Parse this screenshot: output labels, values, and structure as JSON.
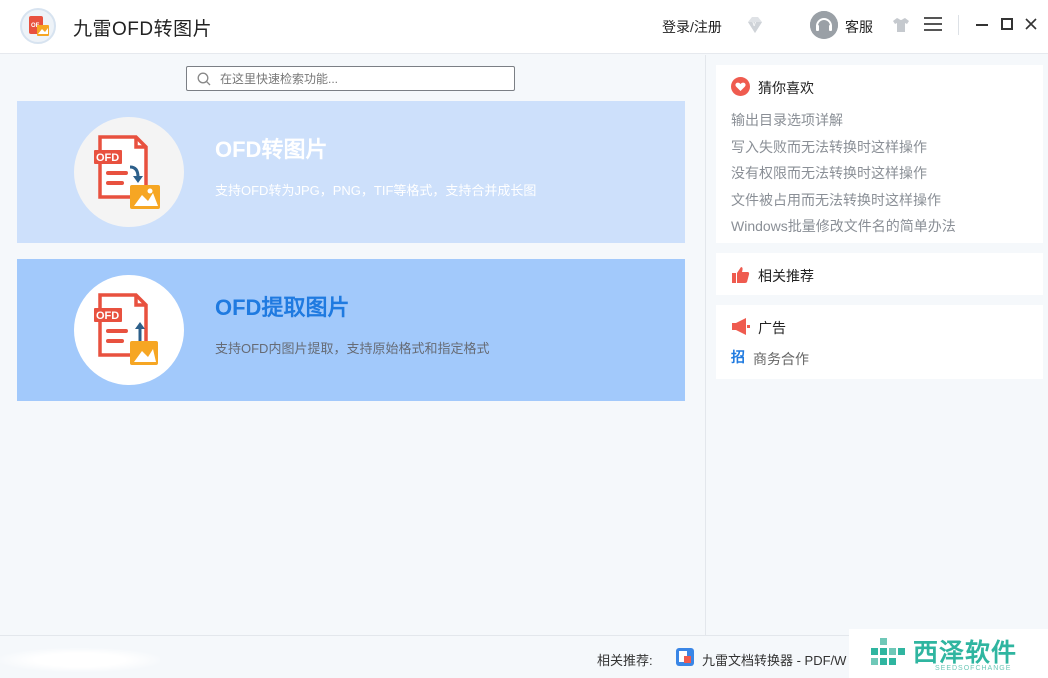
{
  "app": {
    "title": "九雷OFD转图片",
    "login_label": "登录/注册",
    "service_label": "客服"
  },
  "search": {
    "placeholder": "在这里快速检索功能..."
  },
  "cards": [
    {
      "title": "OFD转图片",
      "description": "支持OFD转为JPG，PNG，TIF等格式，支持合并成长图",
      "icon": "ofd-to-image-icon"
    },
    {
      "title": "OFD提取图片",
      "description": "支持OFD内图片提取，支持原始格式和指定格式",
      "icon": "ofd-extract-image-icon"
    }
  ],
  "sidebar": {
    "guess": {
      "title": "猜你喜欢",
      "icon": "heart-icon",
      "items": [
        "输出目录选项详解",
        "写入失败而无法转换时这样操作",
        "没有权限而无法转换时这样操作",
        "文件被占用而无法转换时这样操作",
        "Windows批量修改文件名的简单办法"
      ]
    },
    "recommend": {
      "title": "相关推荐",
      "icon": "thumbs-up-icon"
    },
    "ad": {
      "title": "广告",
      "icon": "megaphone-icon",
      "link_badge": "招",
      "link_label": "商务合作"
    }
  },
  "footer": {
    "label": "相关推荐:",
    "link": "九雷文档转换器 - PDF/W"
  },
  "watermark": {
    "title": "西泽软件",
    "subtitle": "SEEDSOFCHANGE"
  },
  "colors": {
    "accent": "#1f7ae0",
    "card1_bg": "#cde0fb",
    "card2_bg": "#a2c9fb",
    "icon_red": "#e8513f",
    "icon_orange": "#f6a623",
    "watermark_green": "#2fb5a0"
  }
}
